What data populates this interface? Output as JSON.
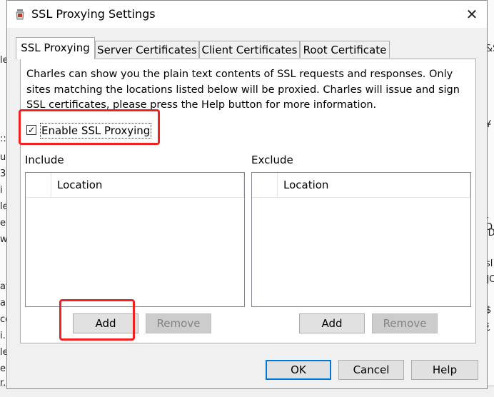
{
  "window": {
    "title": "SSL Proxying Settings",
    "close_glyph": "✕"
  },
  "tabs": [
    {
      "label": "SSL Proxying",
      "active": true
    },
    {
      "label": "Server Certificates",
      "active": false
    },
    {
      "label": "Client Certificates",
      "active": false
    },
    {
      "label": "Root Certificate",
      "active": false
    }
  ],
  "ssl_panel": {
    "description_lines": [
      "Charles can show you the plain text contents of SSL requests and responses. Only",
      "sites matching the locations listed below will be proxied. Charles will issue and sign",
      "SSL certificates, please press the Help button for more information."
    ],
    "enable_checkbox": {
      "label": "Enable SSL Proxying",
      "checked": true,
      "mark": "✓"
    },
    "include": {
      "heading": "Include",
      "column_header": "Location",
      "rows": [],
      "add_label": "Add",
      "remove_label": "Remove"
    },
    "exclude": {
      "heading": "Exclude",
      "column_header": "Location",
      "rows": [],
      "add_label": "Add",
      "remove_label": "Remove"
    }
  },
  "footer": {
    "ok_label": "OK",
    "cancel_label": "Cancel",
    "help_label": "Help"
  },
  "background_fragments": {
    "left": [
      "le",
      "::",
      "u",
      "3(",
      "i",
      "le",
      "e.",
      "w",
      "",
      "at",
      "a",
      "co",
      "u",
      "i.",
      "le",
      "e.",
      "r."
    ],
    "right": [
      "&S",
      "¥",
      "-D",
      "iD",
      "sl",
      "]C",
      "$",
      "¿"
    ]
  },
  "colors": {
    "annotation_red": "#ee2222",
    "focus_blue": "#0078d7",
    "dialog_bg": "#f0f0f0"
  },
  "icons": {
    "app_icon": "charles-jar-icon",
    "close_icon": "close-icon",
    "checkbox_mark": "check-icon"
  }
}
